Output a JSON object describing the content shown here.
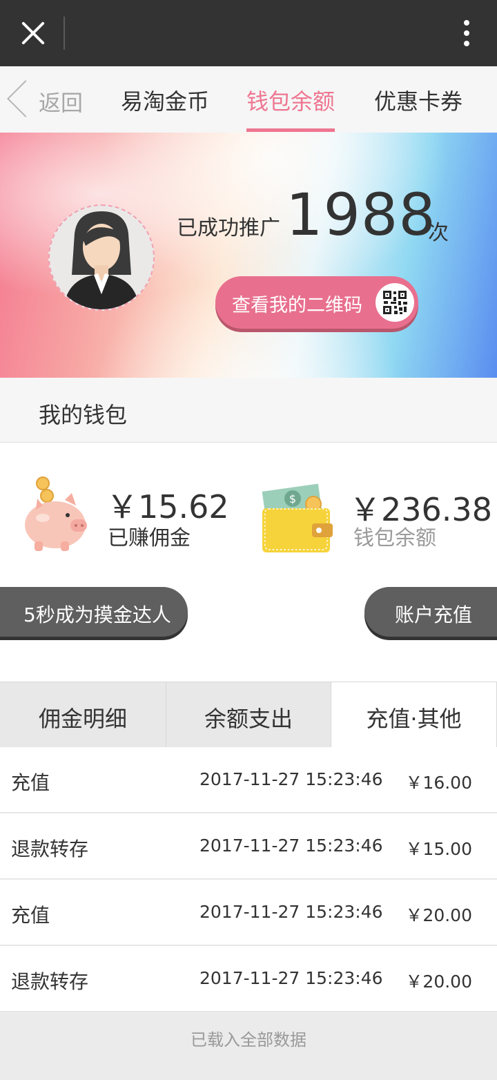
{
  "topbar": {
    "close_icon": "close-icon",
    "more_icon": "more-vertical-icon"
  },
  "nav": {
    "back_label": "返回",
    "tabs": [
      {
        "label": "易淘金币",
        "active": false
      },
      {
        "label": "钱包余额",
        "active": true
      },
      {
        "label": "优惠卡券",
        "active": false
      }
    ],
    "accent_color": "#ee7590"
  },
  "hero": {
    "promo_prefix": "已成功推广",
    "promo_count": "1988",
    "promo_unit": "次",
    "qr_button_label": "查看我的二维码",
    "qr_icon": "qr-code-icon"
  },
  "wallet": {
    "title": "我的钱包",
    "commission": {
      "amount": "￥15.62",
      "label": "已赚佣金",
      "icon": "piggy-bank-icon"
    },
    "balance": {
      "amount": "￥236.38",
      "label": "钱包余额",
      "icon": "wallet-icon"
    },
    "left_button": "5秒成为摸金达人",
    "right_button": "账户充值"
  },
  "detail_tabs": [
    {
      "label": "佣金明细",
      "active": false
    },
    {
      "label": "余额支出",
      "active": false
    },
    {
      "label": "充值·其他",
      "active": true
    }
  ],
  "records": [
    {
      "type": "充值",
      "time": "2017-11-27 15:23:46",
      "amount": "￥16.00"
    },
    {
      "type": "退款转存",
      "time": "2017-11-27 15:23:46",
      "amount": "￥15.00"
    },
    {
      "type": "充值",
      "time": "2017-11-27 15:23:46",
      "amount": "￥20.00"
    },
    {
      "type": "退款转存",
      "time": "2017-11-27 15:23:46",
      "amount": "￥20.00"
    }
  ],
  "footer_note": "已载入全部数据"
}
